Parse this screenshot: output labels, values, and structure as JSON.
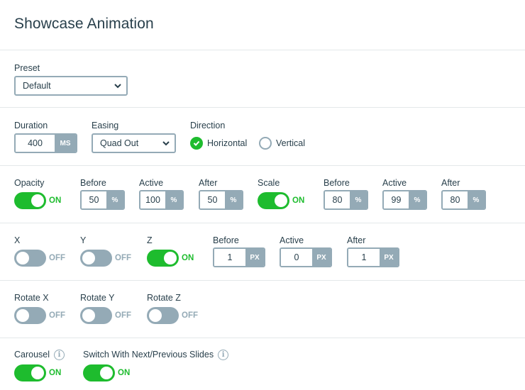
{
  "title": "Showcase Animation",
  "colors": {
    "accent": "#1ebc2e",
    "muted": "#94aab6",
    "text": "#283f4b"
  },
  "preset": {
    "label": "Preset",
    "value": "Default"
  },
  "duration": {
    "label": "Duration",
    "value": "400",
    "unit": "MS"
  },
  "easing": {
    "label": "Easing",
    "value": "Quad Out"
  },
  "direction": {
    "label": "Direction",
    "options": [
      {
        "label": "Horizontal",
        "checked": true
      },
      {
        "label": "Vertical",
        "checked": false
      }
    ]
  },
  "opacity": {
    "label": "Opacity",
    "state": "ON",
    "before": {
      "label": "Before",
      "value": "50",
      "unit": "%"
    },
    "active": {
      "label": "Active",
      "value": "100",
      "unit": "%"
    },
    "after": {
      "label": "After",
      "value": "50",
      "unit": "%"
    }
  },
  "scale": {
    "label": "Scale",
    "state": "ON",
    "before": {
      "label": "Before",
      "value": "80",
      "unit": "%"
    },
    "active": {
      "label": "Active",
      "value": "99",
      "unit": "%"
    },
    "after": {
      "label": "After",
      "value": "80",
      "unit": "%"
    }
  },
  "translate": {
    "x": {
      "label": "X",
      "state": "OFF"
    },
    "y": {
      "label": "Y",
      "state": "OFF"
    },
    "z": {
      "label": "Z",
      "state": "ON"
    },
    "before": {
      "label": "Before",
      "value": "1",
      "unit": "PX"
    },
    "active": {
      "label": "Active",
      "value": "0",
      "unit": "PX"
    },
    "after": {
      "label": "After",
      "value": "1",
      "unit": "PX"
    }
  },
  "rotate": {
    "x": {
      "label": "Rotate X",
      "state": "OFF"
    },
    "y": {
      "label": "Rotate Y",
      "state": "OFF"
    },
    "z": {
      "label": "Rotate Z",
      "state": "OFF"
    }
  },
  "carousel": {
    "label": "Carousel",
    "state": "ON",
    "info_icon": "info-icon"
  },
  "switch_slides": {
    "label": "Switch With Next/Previous Slides",
    "state": "ON",
    "info_icon": "info-icon"
  }
}
